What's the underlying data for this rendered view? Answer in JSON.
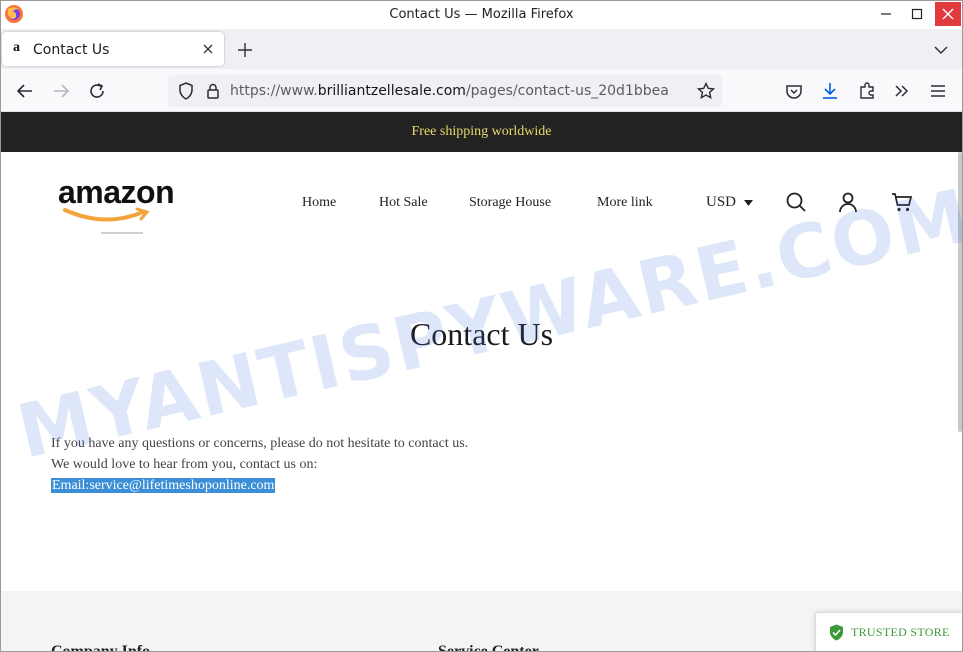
{
  "window": {
    "title": "Contact Us — Mozilla Firefox"
  },
  "tab": {
    "title": "Contact Us",
    "favicon_glyph": "a"
  },
  "urlbar": {
    "prefix": "https://www.",
    "host": "brilliantzellesale.com",
    "path": "/pages/contact-us_20d1bbea"
  },
  "page": {
    "announcement": "Free shipping worldwide",
    "logo_text": "amazon",
    "menu": [
      "Home",
      "Hot Sale",
      "Storage House",
      "More link"
    ],
    "currency": "USD",
    "title": "Contact Us",
    "body": {
      "line1": "If you have any questions or concerns, please do not hesitate to contact us.",
      "line2": "We would love to hear from you, contact us on:",
      "email": "Email:service@lifetimeshoponline.com"
    },
    "footer": {
      "col1": "Company Info",
      "col2": "Service Center"
    },
    "badge": "TRUSTED STORE"
  },
  "watermark": "MYANTISPYWARE.COM",
  "colors": {
    "announcement_bg": "#222222",
    "announcement_text": "#e6dc6a",
    "close_button": "#e0393e",
    "email_highlight": "#3a8fd6",
    "trusted_green": "#3a9a3a"
  }
}
